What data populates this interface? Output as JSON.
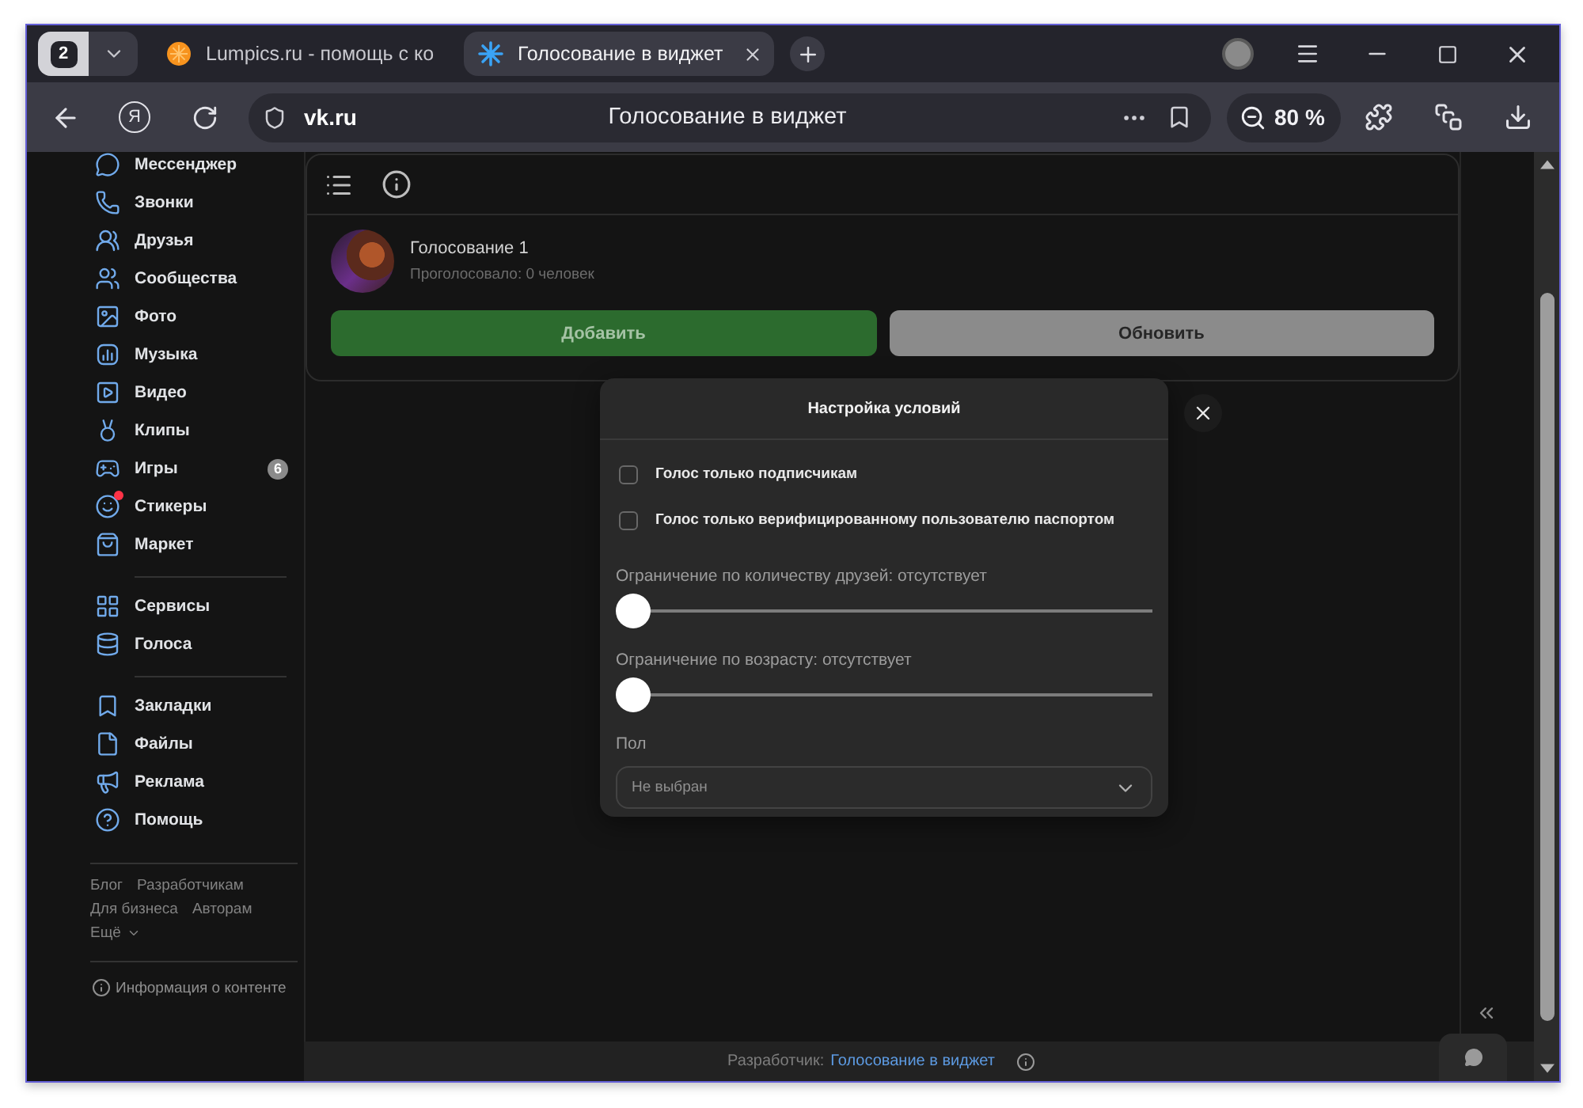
{
  "browser": {
    "tab_counter": "2",
    "tabs": [
      {
        "title": "Lumpics.ru - помощь с ко",
        "selected": false
      },
      {
        "title": "Голосование в виджет",
        "selected": true
      }
    ],
    "home_logo": "Я",
    "address": {
      "domain": "vk.ru",
      "page_title": "Голосование в виджет"
    },
    "zoom": "80 %"
  },
  "sidebar": {
    "groups": [
      {
        "items": [
          {
            "label": "Мессенджер",
            "dot": false
          },
          {
            "label": "Звонки",
            "dot": false
          },
          {
            "label": "Друзья",
            "dot": false
          },
          {
            "label": "Сообщества",
            "dot": false
          },
          {
            "label": "Фото",
            "dot": false
          },
          {
            "label": "Музыка",
            "dot": false
          },
          {
            "label": "Видео",
            "dot": false
          },
          {
            "label": "Клипы",
            "dot": false
          },
          {
            "label": "Игры",
            "dot": false,
            "badge": "6"
          },
          {
            "label": "Стикеры",
            "dot": true
          },
          {
            "label": "Маркет",
            "dot": false
          }
        ]
      },
      {
        "items": [
          {
            "label": "Сервисы",
            "dot": false
          },
          {
            "label": "Голоса",
            "dot": false
          }
        ]
      },
      {
        "items": [
          {
            "label": "Закладки",
            "dot": false
          },
          {
            "label": "Файлы",
            "dot": false
          },
          {
            "label": "Реклама",
            "dot": false
          },
          {
            "label": "Помощь",
            "dot": false
          }
        ]
      }
    ],
    "footer_links": [
      {
        "items": [
          {
            "label": "Блог",
            "kind": "link"
          },
          {
            "label": "Разработчикам",
            "kind": "link"
          }
        ]
      },
      {
        "items": [
          {
            "label": "Для бизнеса",
            "kind": "link"
          },
          {
            "label": "Авторам",
            "kind": "link"
          }
        ]
      },
      {
        "items": [
          {
            "label": "Ещё",
            "kind": "menu"
          }
        ]
      }
    ],
    "content_info": "Информация о контенте"
  },
  "widget": {
    "poll": {
      "title": "Голосование 1",
      "votes": "Проголосовало: 0 человек"
    },
    "buttons": [
      {
        "label": "Добавить",
        "kind": "primary"
      },
      {
        "label": "Обновить",
        "kind": "secondary"
      }
    ]
  },
  "dialog": {
    "title": "Настройка условий",
    "checkboxes": [
      {
        "label": "Голос только подписчикам",
        "checked": false
      },
      {
        "label": "Голос только верифицированному пользователю паспортом",
        "checked": false
      }
    ],
    "sliders": [
      {
        "label": "Ограничение по количеству друзей: отсутствует",
        "level": 0
      },
      {
        "label": "Ограничение по возрасту: отсутствует",
        "level": 0
      }
    ],
    "select": {
      "label": "Пол",
      "value": "Не выбран"
    }
  },
  "footer": {
    "developer_label": "Разработчик:",
    "developer_link": "Голосование в виджет"
  }
}
